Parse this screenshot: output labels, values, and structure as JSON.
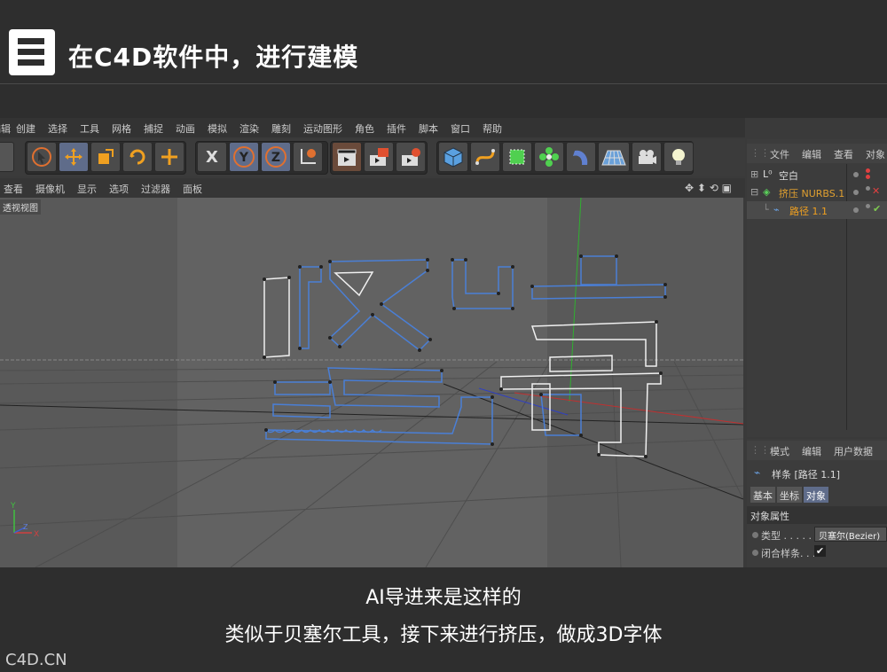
{
  "banner": {
    "step_glyph": "三",
    "title": "在C4D软件中，进行建模"
  },
  "menubar": {
    "items": [
      "编辑",
      "创建",
      "选择",
      "工具",
      "网格",
      "捕捉",
      "动画",
      "模拟",
      "渲染",
      "雕刻",
      "运动图形",
      "角色",
      "插件",
      "脚本",
      "窗口",
      "帮助"
    ]
  },
  "toolbar": {
    "axis_x": "X",
    "axis_y": "Y",
    "axis_z": "Z"
  },
  "viewport_menu": {
    "items": [
      "查看",
      "摄像机",
      "显示",
      "选项",
      "过滤器",
      "面板"
    ],
    "view_label": "透视视图",
    "axis_y": "Y",
    "axis_z": "Z",
    "axis_x": "X"
  },
  "object_manager": {
    "tabs": [
      "文件",
      "编辑",
      "查看",
      "对象"
    ],
    "rows": [
      {
        "name": "空白"
      },
      {
        "name": "挤压 NURBS.1"
      },
      {
        "name": "路径 1.1"
      }
    ]
  },
  "attributes": {
    "tabs": [
      "模式",
      "编辑",
      "用户数据"
    ],
    "object_title": "样条 [路径 1.1]",
    "sub_tabs": [
      "基本",
      "坐标",
      "对象"
    ],
    "section": "对象属性",
    "fields": [
      {
        "label": "类型 . . . . .",
        "value": "贝塞尔(Bezier)"
      },
      {
        "label": "闭合样条. . .",
        "value": "✔"
      }
    ]
  },
  "subtitle": {
    "line1": "AI导进来是这样的",
    "line2": "类似于贝塞尔工具，接下来进行挤压，做成3D字体"
  },
  "watermark": "C4D.CN",
  "colors": {
    "accent": "#5f6c8a",
    "path_blue": "#4a7fd6",
    "path_white": "#ffffff",
    "obj_orange": "#e0a030",
    "check_green": "#7ec850",
    "dot_red": "#e04040"
  }
}
